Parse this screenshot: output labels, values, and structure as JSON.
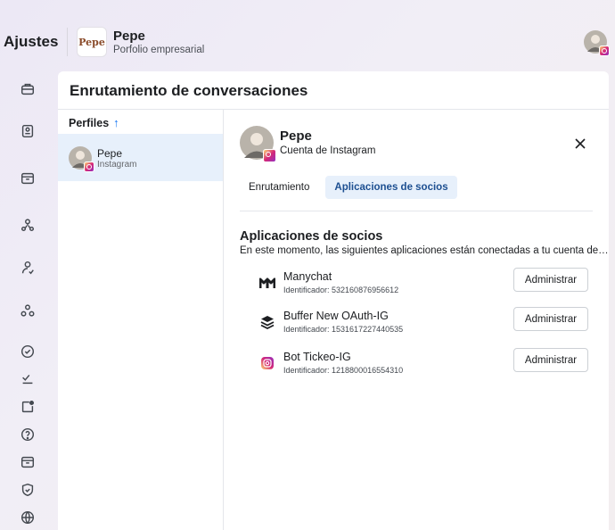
{
  "header": {
    "section_title": "Ajustes",
    "business_name": "Pepe",
    "business_subtitle": "Porfolio empresarial",
    "logo_text": "Pepe"
  },
  "rail": {
    "icons": [
      "briefcase-icon",
      "id-card-icon",
      "inbox-icon",
      "people-network-icon",
      "person-check-icon",
      "partners-icon",
      "check-circle-icon",
      "checkmark-list-icon",
      "notification-square-icon",
      "help-icon",
      "archive-icon",
      "shield-icon",
      "globe-icon"
    ]
  },
  "main": {
    "title": "Enrutamiento de conversaciones",
    "profiles": {
      "header": "Perfiles",
      "items": [
        {
          "name": "Pepe",
          "platform": "Instagram"
        }
      ]
    },
    "detail": {
      "name": "Pepe",
      "account_type": "Cuenta de Instagram",
      "tabs": [
        {
          "label": "Enrutamiento",
          "active": false
        },
        {
          "label": "Aplicaciones de socios",
          "active": true
        }
      ],
      "section_title": "Aplicaciones de socios",
      "section_description": "En este momento, las siguientes aplicaciones están conectadas a tu cuenta de Instagram",
      "apps": [
        {
          "name": "Manychat",
          "id_text": "Identificador: 532160876956612",
          "button": "Administrar",
          "icon": "manychat-icon"
        },
        {
          "name": "Buffer New OAuth-IG",
          "id_text": "Identificador: 1531617227440535",
          "button": "Administrar",
          "icon": "buffer-icon"
        },
        {
          "name": "Bot Tickeo-IG",
          "id_text": "Identificador: 1218800016554310",
          "button": "Administrar",
          "icon": "instagram-icon"
        }
      ]
    }
  },
  "colors": {
    "accent": "#1877f2",
    "selected_bg": "#e7f0fb",
    "active_tab_text": "#1d4f91"
  }
}
